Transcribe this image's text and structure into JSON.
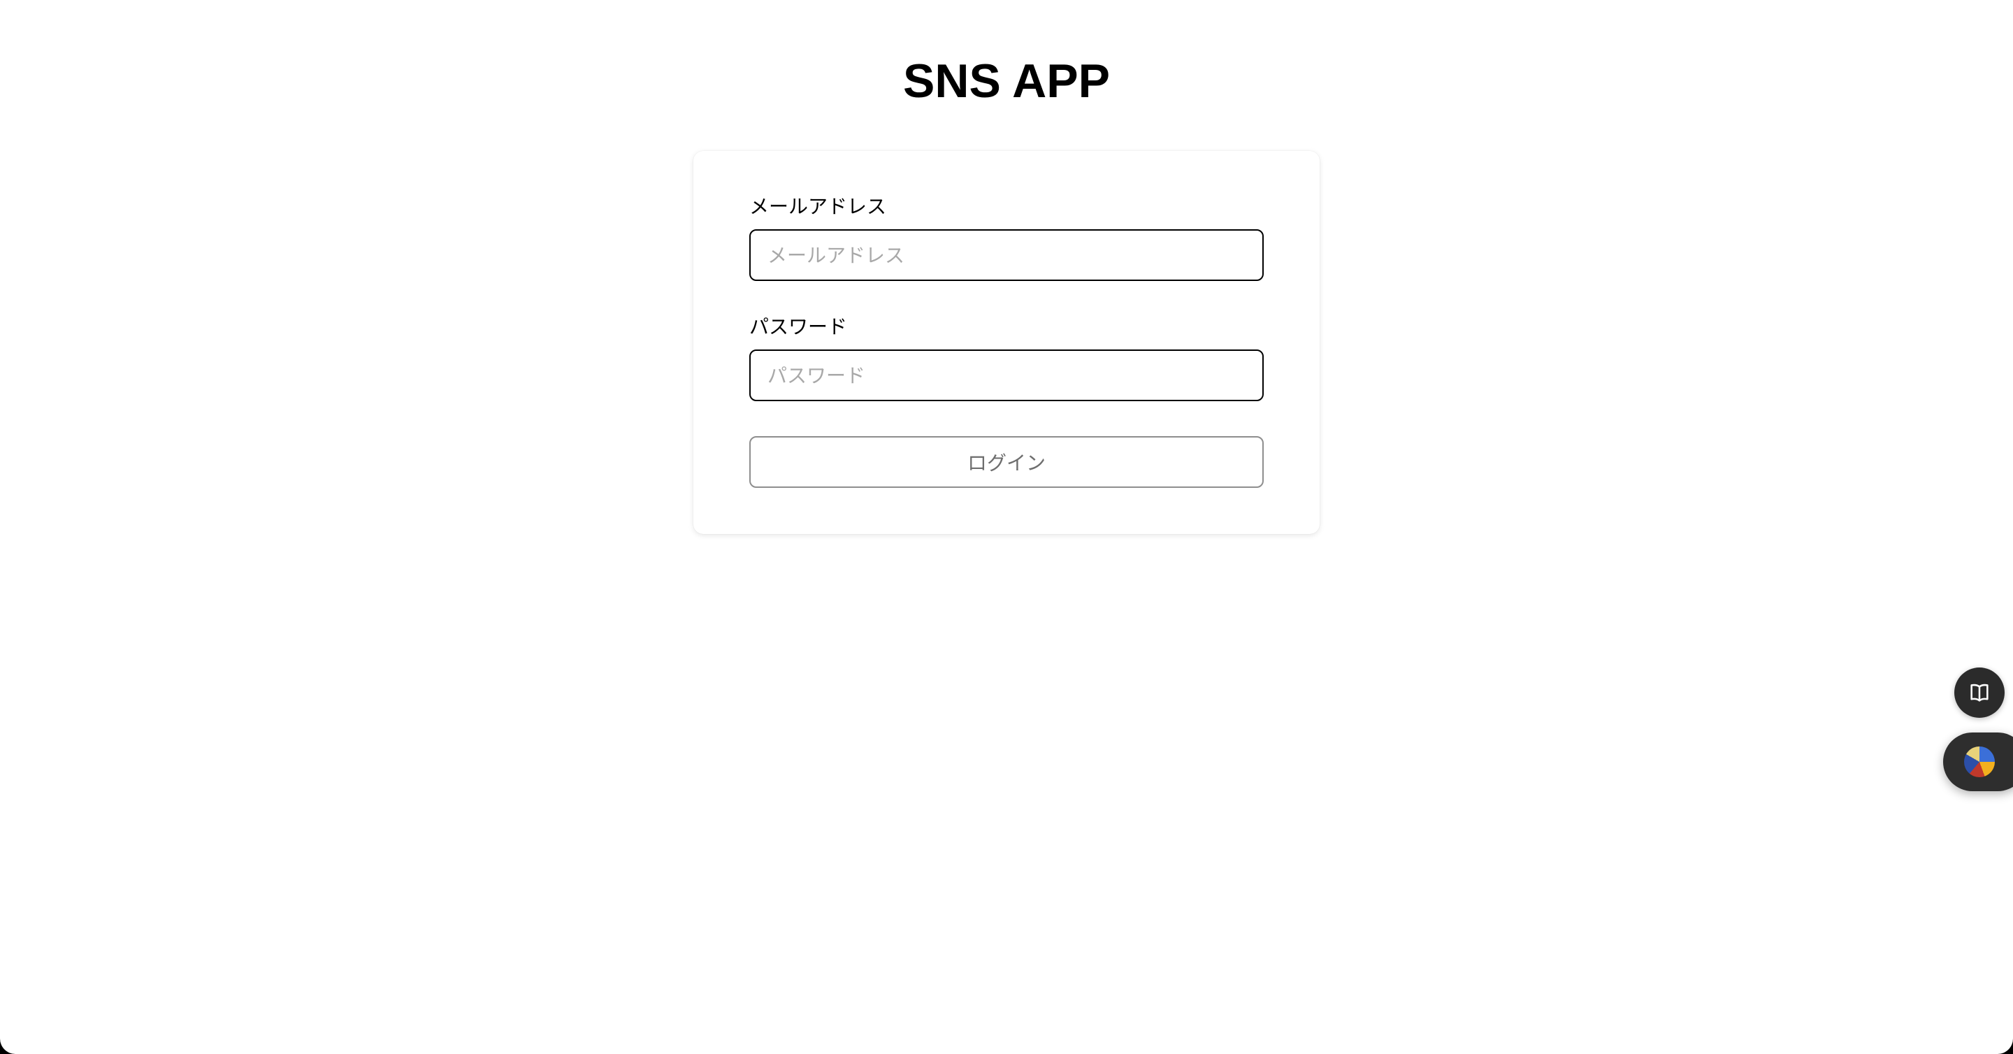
{
  "app": {
    "title": "SNS APP"
  },
  "login_form": {
    "email": {
      "label": "メールアドレス",
      "placeholder": "メールアドレス",
      "value": ""
    },
    "password": {
      "label": "パスワード",
      "placeholder": "パスワード",
      "value": ""
    },
    "submit_label": "ログイン"
  },
  "floating_widgets": {
    "reader_icon": "book-open-icon",
    "extension_icon": "extension-avatar-icon"
  },
  "colors": {
    "background": "#ffffff",
    "text": "#000000",
    "placeholder": "#a8a8a8",
    "button_text": "#6e6e6e",
    "button_border": "#8e8e8e",
    "widget_bg": "#2b2b2b"
  }
}
